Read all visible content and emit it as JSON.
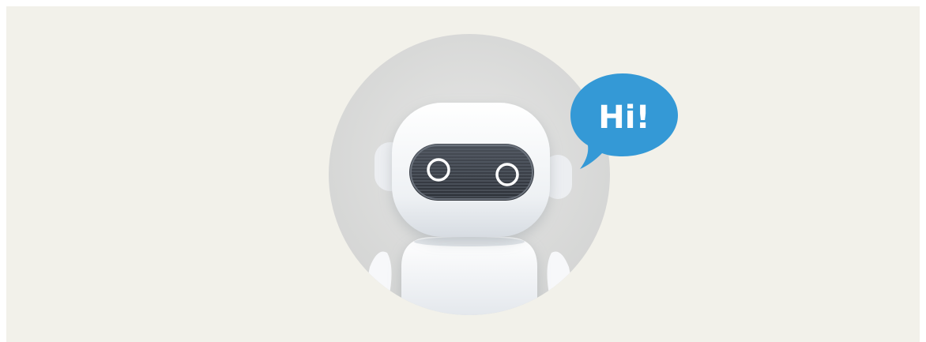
{
  "speech_bubble": {
    "text": "Hi!",
    "color": "#3499d6"
  },
  "colors": {
    "background": "#f2f1ea",
    "avatar_circle": "#d9dad9",
    "robot_body": "#f4f6f8",
    "visor": "#3b4048",
    "eye_ring": "#ffffff"
  },
  "icons": {
    "avatar": "robot-avatar-icon"
  }
}
